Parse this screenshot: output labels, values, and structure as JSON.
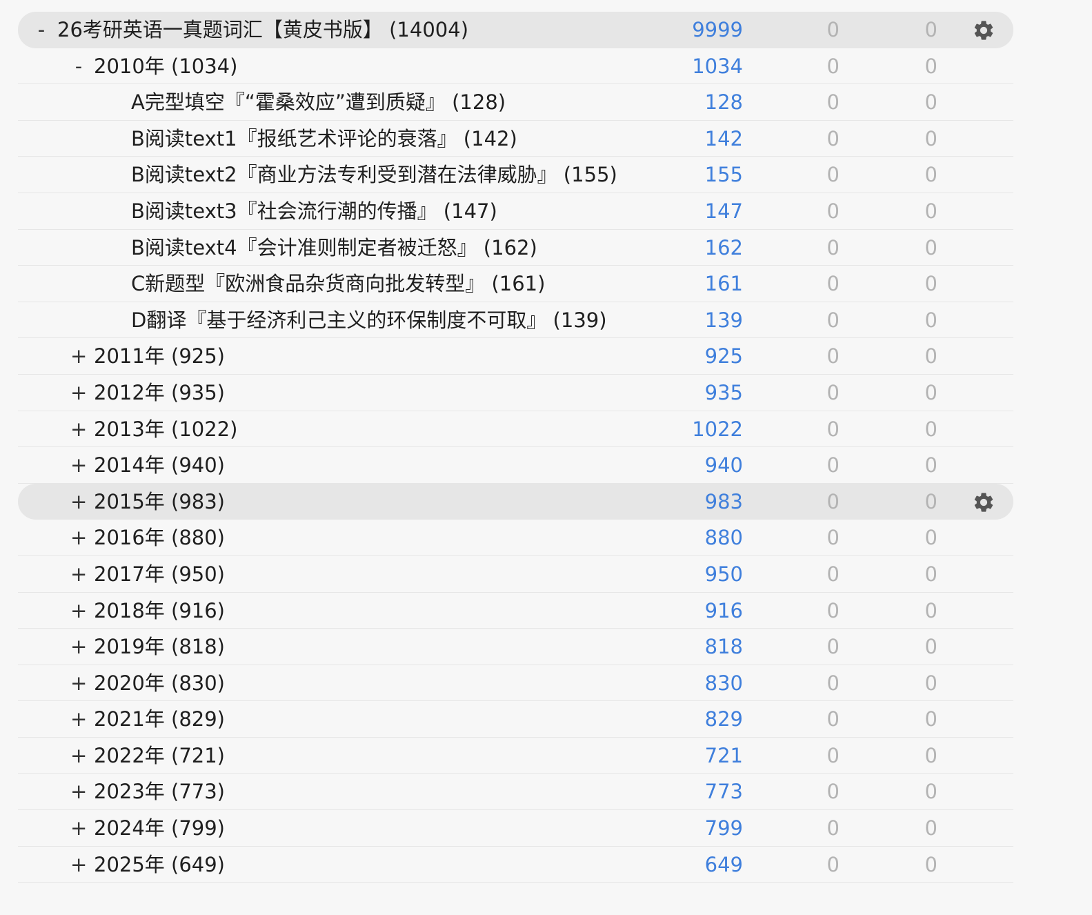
{
  "decks": [
    {
      "level": 0,
      "toggle": "-",
      "name": "26考研英语一真题词汇【黄皮书版】 (14004)",
      "new": "9999",
      "learn": "0",
      "review": "0",
      "current": true
    },
    {
      "level": 1,
      "toggle": "-",
      "name": "2010年 (1034)",
      "new": "1034",
      "learn": "0",
      "review": "0",
      "current": false
    },
    {
      "level": 2,
      "toggle": "",
      "name": "A完型填空『“霍桑效应”遭到质疑』 (128)",
      "new": "128",
      "learn": "0",
      "review": "0",
      "current": false
    },
    {
      "level": 2,
      "toggle": "",
      "name": "B阅读text1『报纸艺术评论的衰落』 (142)",
      "new": "142",
      "learn": "0",
      "review": "0",
      "current": false
    },
    {
      "level": 2,
      "toggle": "",
      "name": "B阅读text2『商业方法专利受到潜在法律威胁』 (155)",
      "new": "155",
      "learn": "0",
      "review": "0",
      "current": false
    },
    {
      "level": 2,
      "toggle": "",
      "name": "B阅读text3『社会流行潮的传播』 (147)",
      "new": "147",
      "learn": "0",
      "review": "0",
      "current": false
    },
    {
      "level": 2,
      "toggle": "",
      "name": "B阅读text4『会计准则制定者被迁怒』 (162)",
      "new": "162",
      "learn": "0",
      "review": "0",
      "current": false
    },
    {
      "level": 2,
      "toggle": "",
      "name": "C新题型『欧洲食品杂货商向批发转型』 (161)",
      "new": "161",
      "learn": "0",
      "review": "0",
      "current": false
    },
    {
      "level": 2,
      "toggle": "",
      "name": "D翻译『基于经济利己主义的环保制度不可取』 (139)",
      "new": "139",
      "learn": "0",
      "review": "0",
      "current": false
    },
    {
      "level": 1,
      "toggle": "+",
      "name": "2011年 (925)",
      "new": "925",
      "learn": "0",
      "review": "0",
      "current": false
    },
    {
      "level": 1,
      "toggle": "+",
      "name": "2012年 (935)",
      "new": "935",
      "learn": "0",
      "review": "0",
      "current": false
    },
    {
      "level": 1,
      "toggle": "+",
      "name": "2013年 (1022)",
      "new": "1022",
      "learn": "0",
      "review": "0",
      "current": false
    },
    {
      "level": 1,
      "toggle": "+",
      "name": "2014年 (940)",
      "new": "940",
      "learn": "0",
      "review": "0",
      "current": false
    },
    {
      "level": 1,
      "toggle": "+",
      "name": "2015年 (983)",
      "new": "983",
      "learn": "0",
      "review": "0",
      "current": true
    },
    {
      "level": 1,
      "toggle": "+",
      "name": "2016年 (880)",
      "new": "880",
      "learn": "0",
      "review": "0",
      "current": false
    },
    {
      "level": 1,
      "toggle": "+",
      "name": "2017年 (950)",
      "new": "950",
      "learn": "0",
      "review": "0",
      "current": false
    },
    {
      "level": 1,
      "toggle": "+",
      "name": "2018年 (916)",
      "new": "916",
      "learn": "0",
      "review": "0",
      "current": false
    },
    {
      "level": 1,
      "toggle": "+",
      "name": "2019年 (818)",
      "new": "818",
      "learn": "0",
      "review": "0",
      "current": false
    },
    {
      "level": 1,
      "toggle": "+",
      "name": "2020年 (830)",
      "new": "830",
      "learn": "0",
      "review": "0",
      "current": false
    },
    {
      "level": 1,
      "toggle": "+",
      "name": "2021年 (829)",
      "new": "829",
      "learn": "0",
      "review": "0",
      "current": false
    },
    {
      "level": 1,
      "toggle": "+",
      "name": "2022年 (721)",
      "new": "721",
      "learn": "0",
      "review": "0",
      "current": false
    },
    {
      "level": 1,
      "toggle": "+",
      "name": "2023年 (773)",
      "new": "773",
      "learn": "0",
      "review": "0",
      "current": false
    },
    {
      "level": 1,
      "toggle": "+",
      "name": "2024年 (799)",
      "new": "799",
      "learn": "0",
      "review": "0",
      "current": false
    },
    {
      "level": 1,
      "toggle": "+",
      "name": "2025年 (649)",
      "new": "649",
      "learn": "0",
      "review": "0",
      "current": false
    }
  ],
  "colors": {
    "new_count": "#3f7fdc",
    "zero_count": "#b3b3b3",
    "row_highlight": "#e6e6e6",
    "background": "#f7f7f7"
  },
  "icons": {
    "options": "gear-icon"
  }
}
